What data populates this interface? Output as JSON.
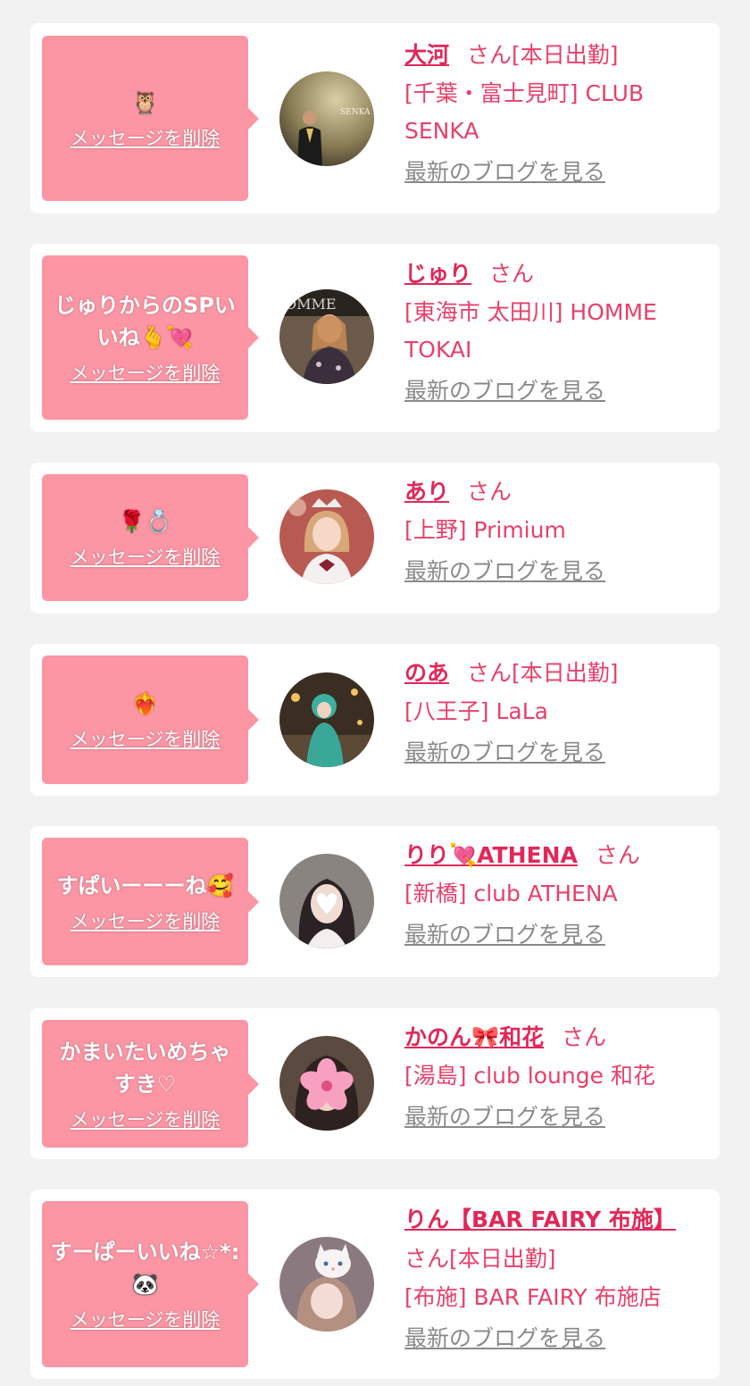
{
  "colors": {
    "page_bg": "#f2f2f2",
    "card_bg": "#ffffff",
    "bubble_bg": "#fc95a4",
    "name_pink": "#e02859",
    "text_pink": "#e8406a",
    "link_gray": "#8a8a8a"
  },
  "delete_label": "メッセージを削除",
  "blog_label": "最新のブログを見る",
  "cards": [
    {
      "message": "🦉",
      "name": "大河",
      "san": "さん[本日出勤]",
      "shop": "[千葉・富士見町] CLUB SENKA",
      "avatar_icon": "portrait-man-suit"
    },
    {
      "message": "じゅりからのSPいいね🫰💘",
      "name": "じゅり",
      "san": "さん",
      "shop": "[東海市 太田川] HOMME TOKAI",
      "avatar_icon": "portrait-woman-dress"
    },
    {
      "message": "🌹💍",
      "name": "あり",
      "san": "さん",
      "shop": "[上野] Primium",
      "avatar_icon": "portrait-woman-tiara"
    },
    {
      "message": "❤️‍🔥",
      "name": "のあ",
      "san": "さん[本日出勤]",
      "shop": "[八王子] LaLa",
      "avatar_icon": "portrait-costume"
    },
    {
      "message": "すぱいーーーね🥰",
      "name": "りり💘ATHENA",
      "san": "さん",
      "shop": "[新橋] club ATHENA",
      "avatar_icon": "portrait-heart-face"
    },
    {
      "message": "かまいたいめちゃすき♡",
      "name": "かのん🎀和花",
      "san": "さん",
      "shop": "[湯島] club lounge 和花",
      "avatar_icon": "portrait-cherry-blossom"
    },
    {
      "message": "すーぱーいいね☆*:🐼",
      "name": "りん【BAR FAIRY 布施】",
      "san": "さん[本日出勤]",
      "shop": "[布施] BAR FAIRY 布施店",
      "avatar_icon": "portrait-cat-filter"
    }
  ]
}
